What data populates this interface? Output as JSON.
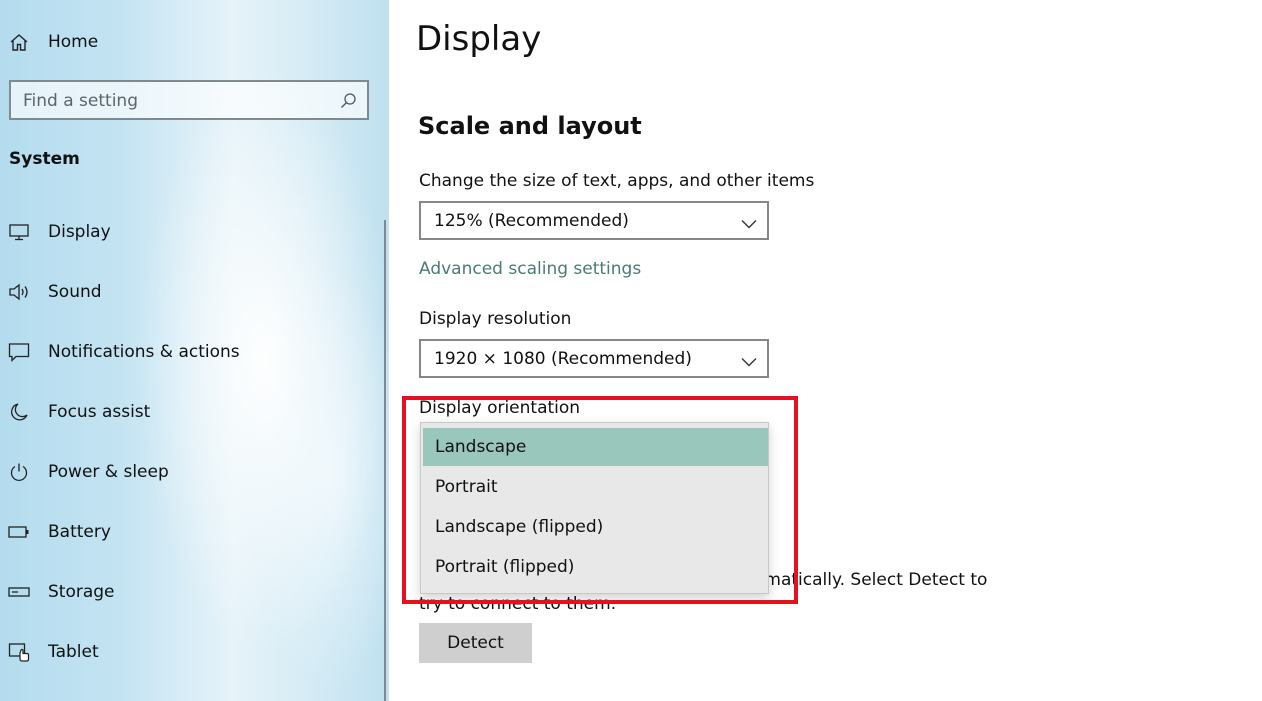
{
  "sidebar": {
    "home_label": "Home",
    "search_placeholder": "Find a setting",
    "section_title": "System",
    "items": [
      {
        "label": "Display",
        "icon": "monitor-icon"
      },
      {
        "label": "Sound",
        "icon": "speaker-icon"
      },
      {
        "label": "Notifications & actions",
        "icon": "notification-icon"
      },
      {
        "label": "Focus assist",
        "icon": "moon-icon"
      },
      {
        "label": "Power & sleep",
        "icon": "power-icon"
      },
      {
        "label": "Battery",
        "icon": "battery-icon"
      },
      {
        "label": "Storage",
        "icon": "storage-icon"
      },
      {
        "label": "Tablet",
        "icon": "tablet-icon"
      }
    ]
  },
  "main": {
    "title": "Display",
    "section_title": "Scale and layout",
    "scale_label": "Change the size of text, apps, and other items",
    "scale_value": "125% (Recommended)",
    "advanced_link": "Advanced scaling settings",
    "resolution_label": "Display resolution",
    "resolution_value": "1920 × 1080 (Recommended)",
    "orientation_label": "Display orientation",
    "orientation_options": [
      "Landscape",
      "Portrait",
      "Landscape (flipped)",
      "Portrait (flipped)"
    ],
    "orientation_selected": "Landscape",
    "detect_text_visible": "omatically. Select Detect to",
    "detect_text_line2": "try to connect to them.",
    "detect_button": "Detect"
  },
  "colors": {
    "accent_link": "#4a7b74",
    "selected_item": "#9ac7bb",
    "highlight_box": "#e3121e"
  }
}
